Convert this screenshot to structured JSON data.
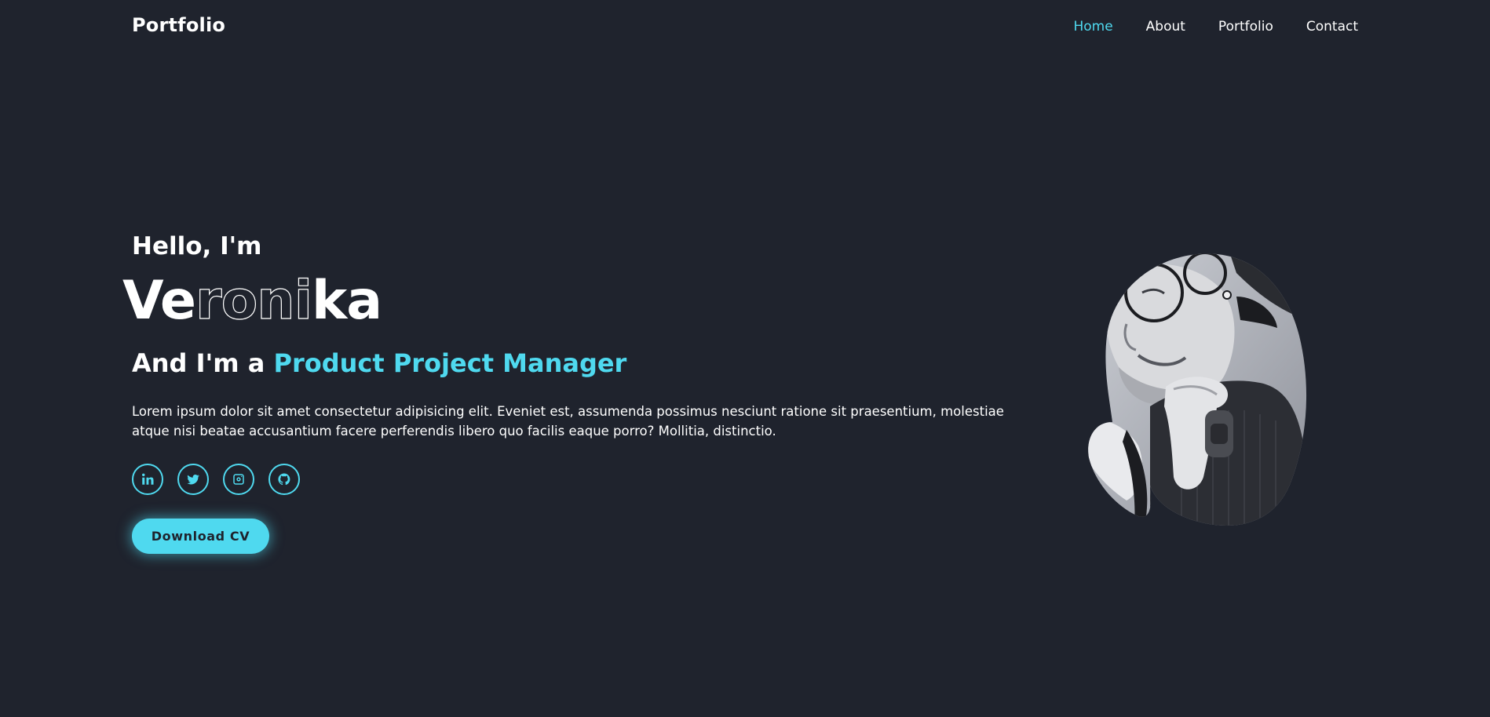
{
  "header": {
    "logo": "Portfolio",
    "nav": [
      {
        "label": "Home",
        "active": true
      },
      {
        "label": "About",
        "active": false
      },
      {
        "label": "Portfolio",
        "active": false
      },
      {
        "label": "Contact",
        "active": false
      }
    ]
  },
  "hero": {
    "greeting": "Hello, I'm",
    "name_parts": [
      "Ve",
      "roni",
      "ka"
    ],
    "role_prefix": "And I'm a",
    "role_highlight": "Product Project Manager",
    "description": "Lorem ipsum dolor sit amet consectetur adipisicing elit. Eveniet est, assumenda possimus nesciunt ratione sit praesentium, molestiae atque nisi beatae accusantium facere perferendis libero quo facilis eaque porro? Mollitia, distinctio.",
    "socials": [
      {
        "icon": "linkedin-icon"
      },
      {
        "icon": "twitter-icon"
      },
      {
        "icon": "instagram-icon"
      },
      {
        "icon": "github-icon"
      }
    ],
    "cta_label": "Download CV",
    "photo": "portrait-photo"
  },
  "colors": {
    "background": "#1f232d",
    "accent": "#4fd9ef",
    "text": "#ffffff"
  }
}
